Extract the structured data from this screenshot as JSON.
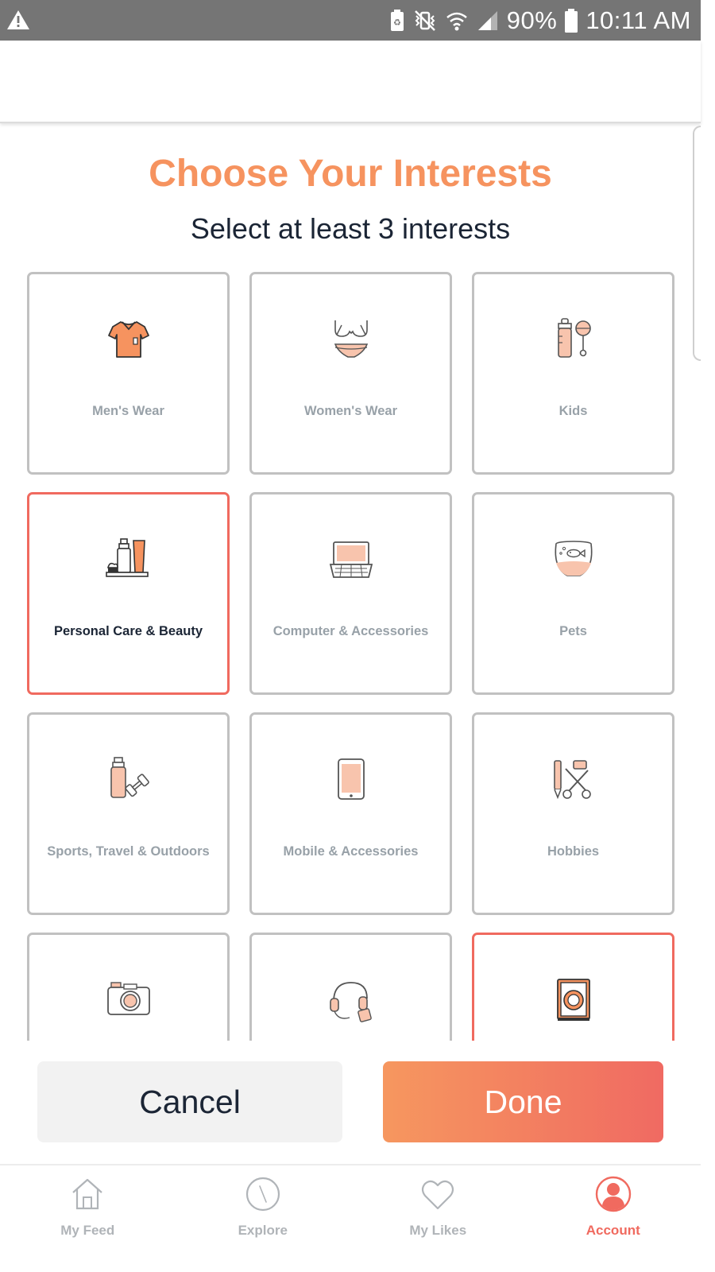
{
  "status_bar": {
    "battery": "90%",
    "time": "10:11 AM"
  },
  "page": {
    "title": "Choose Your Interests",
    "subtitle": "Select at least 3 interests"
  },
  "interests": [
    {
      "label": "Men's Wear",
      "icon": "shirt-icon",
      "selected": true
    },
    {
      "label": "Women's Wear",
      "icon": "lingerie-icon",
      "selected": false
    },
    {
      "label": "Kids",
      "icon": "baby-bottle-rattle-icon",
      "selected": false
    },
    {
      "label": "Personal Care & Beauty",
      "icon": "cosmetics-icon",
      "selected": true
    },
    {
      "label": "Computer & Accessories",
      "icon": "laptop-icon",
      "selected": false
    },
    {
      "label": "Pets",
      "icon": "fishbowl-icon",
      "selected": false
    },
    {
      "label": "Sports, Travel & Outdoors",
      "icon": "bottle-dumbbell-icon",
      "selected": false
    },
    {
      "label": "Mobile & Accessories",
      "icon": "tablet-icon",
      "selected": false
    },
    {
      "label": "Hobbies",
      "icon": "craft-tools-icon",
      "selected": false
    },
    {
      "label": "",
      "icon": "camera-icon",
      "selected": false
    },
    {
      "label": "",
      "icon": "headphones-icon",
      "selected": false
    },
    {
      "label": "",
      "icon": "washing-machine-icon",
      "selected": true
    }
  ],
  "actions": {
    "cancel_label": "Cancel",
    "done_label": "Done"
  },
  "bottom_nav": [
    {
      "label": "My Feed",
      "icon": "home-icon",
      "active": false
    },
    {
      "label": "Explore",
      "icon": "compass-icon",
      "active": false
    },
    {
      "label": "My Likes",
      "icon": "heart-icon",
      "active": false
    },
    {
      "label": "Account",
      "icon": "account-icon",
      "active": true
    }
  ],
  "colors": {
    "accent": "#f6935f",
    "selected_border": "#f06a5f",
    "unselected_border": "#c1c1c1",
    "text_dark": "#1b2535",
    "text_muted": "#98a1a8"
  }
}
